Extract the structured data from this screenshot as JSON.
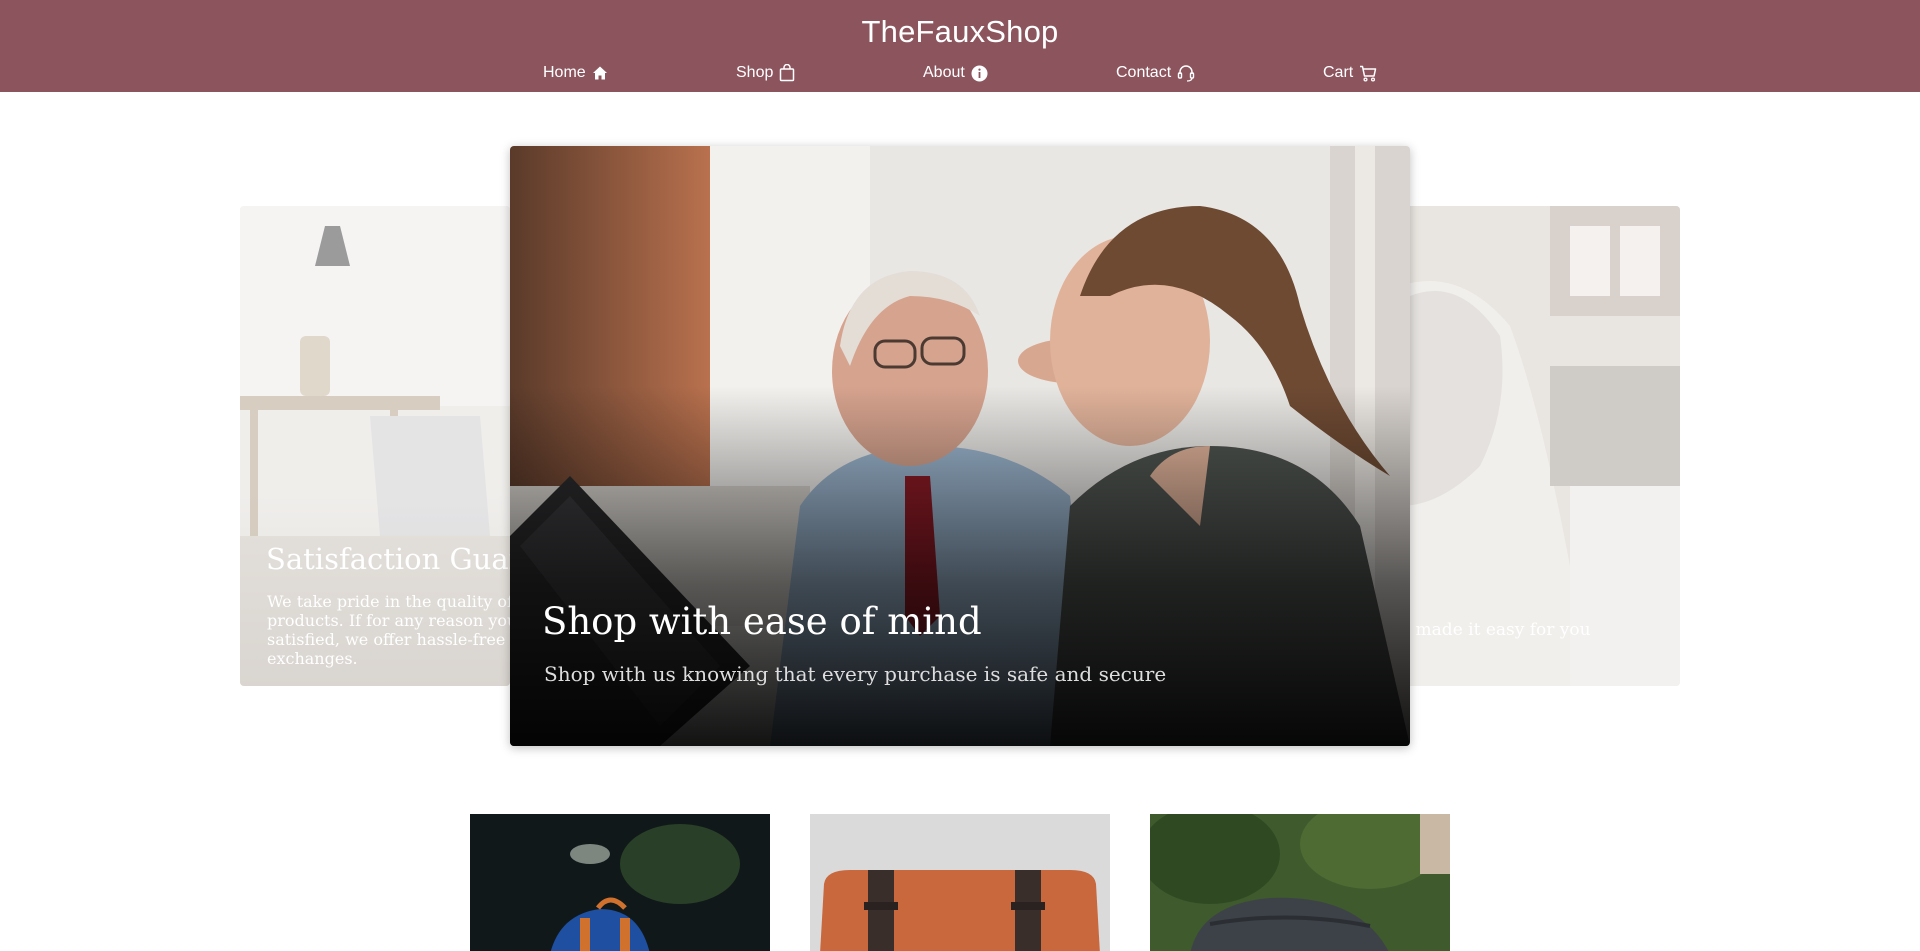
{
  "header": {
    "brand": "TheFauxShop",
    "nav": [
      {
        "label": "Home",
        "icon": "home-icon"
      },
      {
        "label": "Shop",
        "icon": "shopping-bag-icon"
      },
      {
        "label": "About",
        "icon": "info-icon"
      },
      {
        "label": "Contact",
        "icon": "headset-icon"
      },
      {
        "label": "Cart",
        "icon": "cart-icon"
      }
    ]
  },
  "carousel": {
    "left": {
      "title": "Satisfaction Guarantee",
      "text": "We take pride in the quality of our products. If for any reason you're not satisfied, we offer hassle-free returns and exchanges."
    },
    "main": {
      "title": "Shop with ease of mind",
      "subtitle": "Shop with us knowing that every purchase is safe and secure"
    },
    "right": {
      "text": "We made it easy for you"
    }
  },
  "products": [
    {
      "image": "blue-leather-backpack"
    },
    {
      "image": "tan-leather-messenger-bag"
    },
    {
      "image": "grey-backpack-outdoors"
    }
  ],
  "colors": {
    "header_bg": "#8c555e",
    "header_text": "#ffffff"
  }
}
